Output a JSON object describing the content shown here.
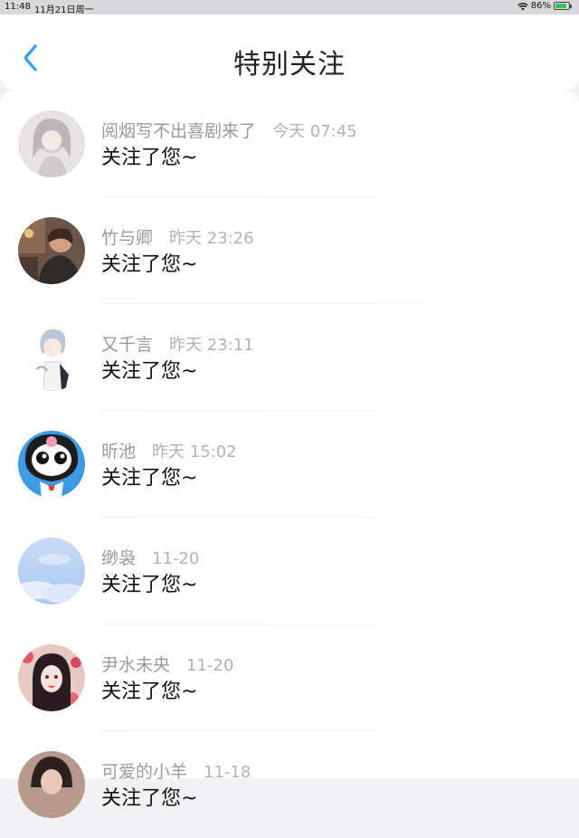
{
  "status_bar": {
    "time": "11:48",
    "date": "11月21日周一",
    "battery": "86%",
    "battery_level": 0.86
  },
  "header": {
    "title": "特别关注",
    "back_icon": "chevron-left-icon"
  },
  "list": [
    {
      "name": "阅烟写不出喜剧来了",
      "time": "今天 07:45",
      "message": "关注了您~"
    },
    {
      "name": "竹与卿",
      "time": "昨天 23:26",
      "message": "关注了您~"
    },
    {
      "name": "又千言",
      "time": "昨天 23:11",
      "message": "关注了您~"
    },
    {
      "name": "昕池",
      "time": "昨天 15:02",
      "message": "关注了您~"
    },
    {
      "name": "缈袅",
      "time": "11-20",
      "message": "关注了您~"
    },
    {
      "name": "尹水未央",
      "time": "11-20",
      "message": "关注了您~"
    },
    {
      "name": "可爱的小羊",
      "time": "11-18",
      "message": "关注了您~"
    }
  ],
  "colors": {
    "accent": "#2f9cf0",
    "battery": "#34c759"
  }
}
